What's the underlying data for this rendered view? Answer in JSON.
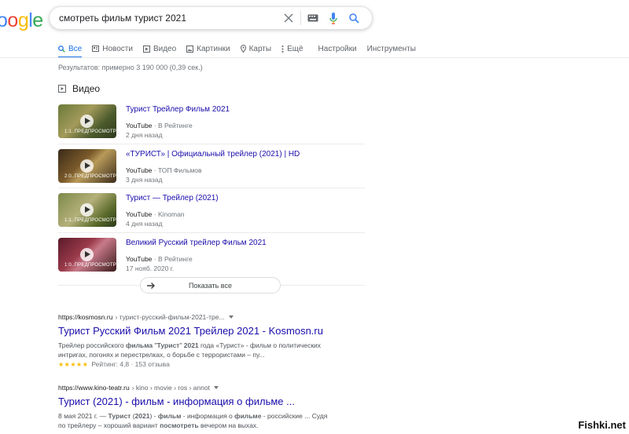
{
  "logo": {
    "text": "oogle"
  },
  "search": {
    "query": "смотреть фильм турист 2021"
  },
  "tabs": [
    {
      "label": "Все",
      "icon": "search-icon"
    },
    {
      "label": "Новости",
      "icon": "news-icon"
    },
    {
      "label": "Видео",
      "icon": "video-icon"
    },
    {
      "label": "Картинки",
      "icon": "image-icon"
    },
    {
      "label": "Карты",
      "icon": "map-pin-icon"
    },
    {
      "label": "Ещё",
      "icon": "more-vert-icon"
    },
    {
      "label": "Настройки"
    },
    {
      "label": "Инструменты"
    }
  ],
  "stats": "Результатов: примерно 3 190 000 (0,39 сек.)",
  "videos": {
    "heading": "Видео",
    "items": [
      {
        "title": "Турист Трейлер Фильм 2021",
        "source": "YouTube",
        "channel": "· В Рейтинге",
        "date": "2 дня назад",
        "thumb_text": "1:1..ПРЕДПРОСМОТР"
      },
      {
        "title": "«ТУРИСТ» | Официальный трейлер (2021) | HD",
        "source": "YouTube",
        "channel": "· ТОП Фильмов",
        "date": "3 дня назад",
        "thumb_text": "2:0..ПРЕДПРОСМОТР"
      },
      {
        "title": "Турист — Трейлер (2021)",
        "source": "YouTube",
        "channel": "· Kinoman",
        "date": "4 дня назад",
        "thumb_text": "1:1..ПРЕДПРОСМОТР"
      },
      {
        "title": "Великий Русский трейлер Фильм 2021",
        "source": "YouTube",
        "channel": "· В Рейтинге",
        "date": "17 нояб. 2020 г.",
        "thumb_text": "1:0..ПРЕДПРОСМОТР"
      }
    ],
    "show_all": "Показать все"
  },
  "results": [
    {
      "url": "https://kosmosn.ru",
      "crumb": "› турист-русский-фильм-2021-тре...",
      "title": "Турист Русский Фильм 2021 Трейлер 2021 - Kosmosn.ru",
      "snippet_html": "Трейлер российского <b>фильма</b> \"<b>Турист</b>\" <b>2021</b> года «Турист» - фильм о политических интригах, погонях и перестрелках, о борьбе с террористами – пу...",
      "stars": "★★★★★",
      "rating": "Рейтинг: 4,8 · 153 отзыва"
    },
    {
      "url": "https://www.kino-teatr.ru",
      "crumb": "› kino › movie › ros › annot",
      "title": "Турист (2021) - фильм - информация о фильме ...",
      "snippet_html": "8 мая 2021 г. — <b>Турист</b> (<b>2021</b>) - <b>фильм</b> - информация о <b>фильме</b> - российские ... Судя по трейлеру – хороший вариант <b>посмотреть</b> вечером на выхах."
    }
  ],
  "watermark": "Fishki.net",
  "colors": {
    "link": "#1a0dab",
    "accent": "#1a73e8",
    "star": "#fbbc05"
  }
}
